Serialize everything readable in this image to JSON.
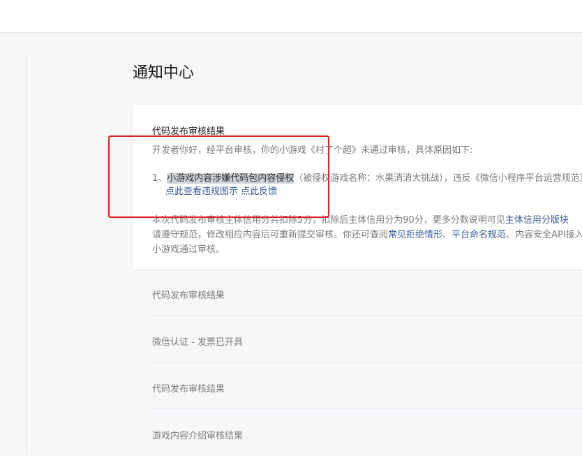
{
  "page": {
    "title": "通知中心"
  },
  "card": {
    "title": "代码发布审核结果",
    "greeting": "开发者你好，经平台审核，你的小游戏《村了个超》未通过审核，具体原因如下:",
    "item_prefix": "1、",
    "item_highlight": "小游戏内容涉嫌代码包内容侵权",
    "item_rest": "（被侵权游戏名称：水果消消大挑战），违反《微信小程序平台运营规范》",
    "link_view": "点此查看违规图示",
    "link_feedback": "点此反馈",
    "credit_text_1": "本次代码发布审核主体信用分共扣除5分，扣除后主体信用分为90分，更多分数说明可见",
    "credit_link": "主体信用分版块",
    "fix_text_1": "请遵守规范，修改相应内容后可重新提交审核。你还可查阅",
    "fix_link_1": "常见拒绝情形",
    "fix_sep_1": "、",
    "fix_link_2": "平台命名规范",
    "fix_sep_2": "、",
    "fix_text_2": "内容安全API接入指引",
    "final_text": "小游戏通过审核。"
  },
  "list": [
    {
      "label": "代码发布审核结果"
    },
    {
      "label": "微信认证 - 发票已开具"
    },
    {
      "label": "代码发布审核结果"
    },
    {
      "label": "游戏内容介绍审核结果"
    }
  ]
}
